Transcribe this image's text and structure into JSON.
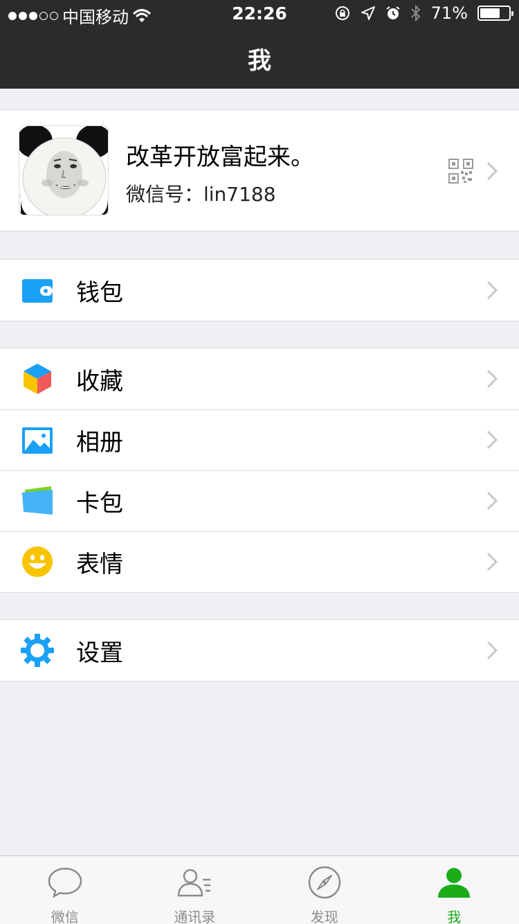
{
  "status_bar": {
    "carrier": "中国移动",
    "time": "22:26",
    "battery_percent": "71%",
    "battery_level": 0.71,
    "icons": [
      "signal-dots",
      "wifi-icon",
      "rotation-lock-icon",
      "location-icon",
      "alarm-icon",
      "bluetooth-icon",
      "battery-icon"
    ]
  },
  "navbar": {
    "title": "我"
  },
  "profile": {
    "name": "改革开放富起来。",
    "wechat_id": "微信号：lin7188",
    "avatar_icon": "panda-meme-avatar",
    "qr_icon": "qrcode-icon"
  },
  "menu": {
    "wallet": {
      "label": "钱包",
      "icon": "wallet-icon",
      "color": "#1aa0f5"
    },
    "favorites": {
      "label": "收藏",
      "icon": "cube-icon"
    },
    "album": {
      "label": "相册",
      "icon": "photo-icon",
      "color": "#1aa0f5"
    },
    "cards": {
      "label": "卡包",
      "icon": "card-icon",
      "color": "#44b4f6"
    },
    "stickers": {
      "label": "表情",
      "icon": "smiley-icon",
      "color": "#f8c400"
    },
    "settings": {
      "label": "设置",
      "icon": "gear-icon",
      "color": "#1aa0f5"
    }
  },
  "tabbar": {
    "tabs": [
      {
        "label": "微信",
        "icon": "chat-bubble-icon",
        "active": false
      },
      {
        "label": "通讯录",
        "icon": "contacts-icon",
        "active": false
      },
      {
        "label": "发现",
        "icon": "compass-icon",
        "active": false
      },
      {
        "label": "我",
        "icon": "person-icon",
        "active": true
      }
    ],
    "active_color": "#1aad19"
  }
}
